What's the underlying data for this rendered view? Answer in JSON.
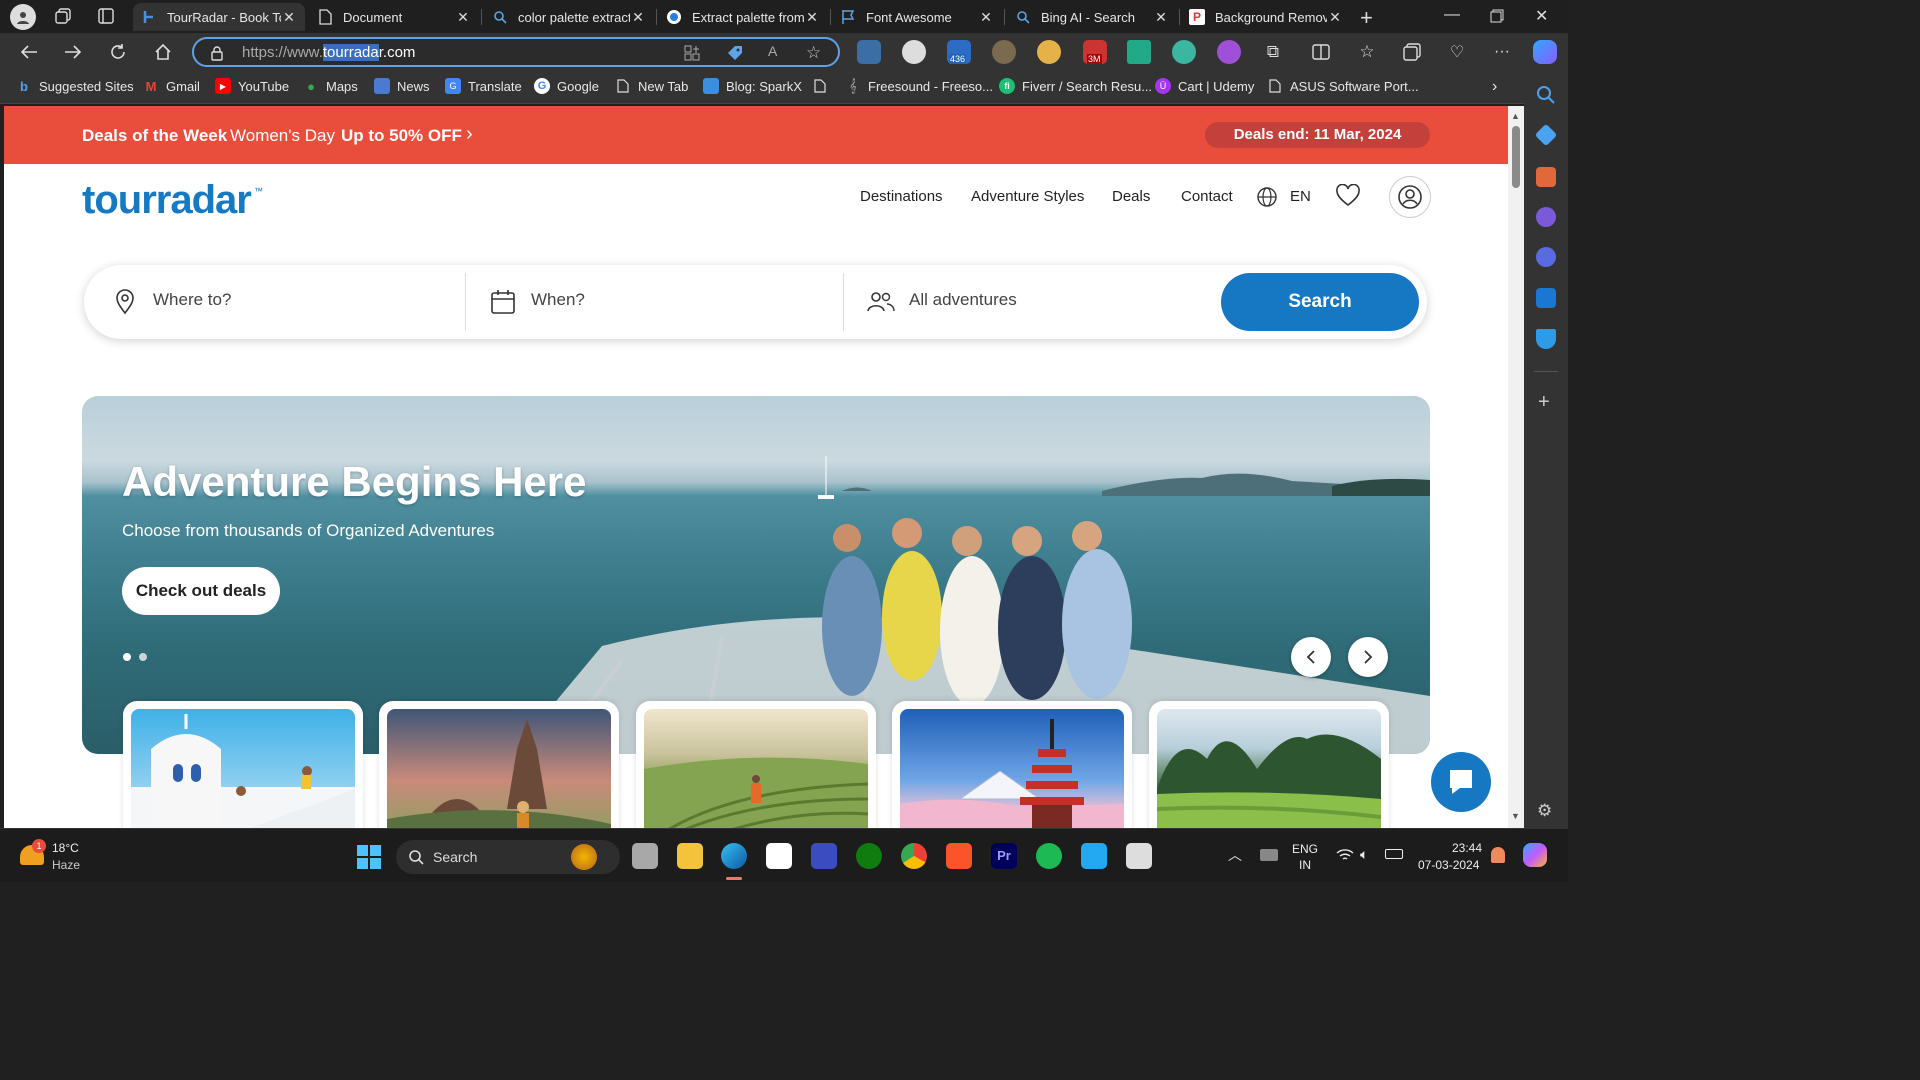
{
  "browser": {
    "tabs": [
      {
        "title": "TourRadar - Book To",
        "active": true
      },
      {
        "title": "Document"
      },
      {
        "title": "color palette extract"
      },
      {
        "title": "Extract palette from"
      },
      {
        "title": "Font Awesome"
      },
      {
        "title": "Bing AI - Search"
      },
      {
        "title": "Background Remov"
      }
    ],
    "url": {
      "prefix": "https://www.",
      "selected": "tourrada",
      "suffix": "r.com"
    },
    "extension_badges": {
      "badge1": "436",
      "badge2": "3M"
    },
    "bookmarks": [
      "Suggested Sites",
      "Gmail",
      "YouTube",
      "Maps",
      "News",
      "Translate",
      "Google",
      "New Tab",
      "Blog: SparkX",
      "",
      "Freesound - Freeso...",
      "Fiverr / Search Resu...",
      "Cart | Udemy",
      "ASUS Software Port..."
    ]
  },
  "promo": {
    "title": "Deals of the Week",
    "event": "Women's Day",
    "offer": "Up to 50% OFF",
    "deals_end": "Deals end: 11 Mar, 2024"
  },
  "header": {
    "logo": "tourradar",
    "nav": [
      "Destinations",
      "Adventure Styles",
      "Deals",
      "Contact"
    ],
    "language": "EN"
  },
  "search": {
    "where_placeholder": "Where to?",
    "when_placeholder": "When?",
    "adventures": "All adventures",
    "button": "Search"
  },
  "hero": {
    "title": "Adventure Begins Here",
    "subtitle": "Choose from thousands of Organized Adventures",
    "cta": "Check out deals"
  },
  "colors": {
    "accent": "#1678c2",
    "promo": "#e94e3d"
  },
  "taskbar": {
    "weather": {
      "temp": "18°C",
      "condition": "Haze"
    },
    "search": "Search",
    "lang": {
      "line1": "ENG",
      "line2": "IN"
    },
    "time": "23:44",
    "date": "07-03-2024",
    "notification_count": "1"
  }
}
